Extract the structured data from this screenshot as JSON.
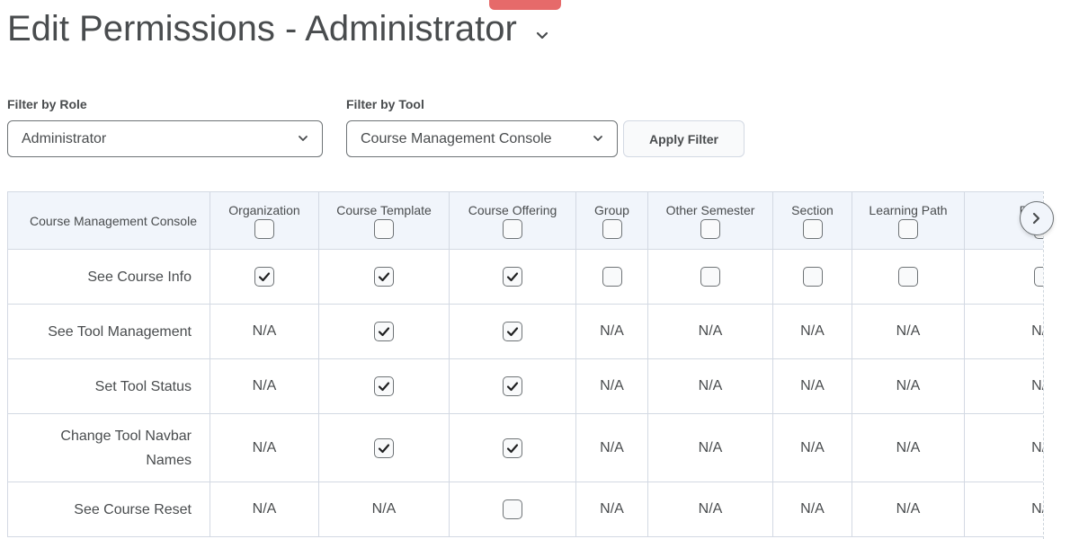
{
  "page": {
    "title": "Edit Permissions - Administrator"
  },
  "filters": {
    "role": {
      "label": "Filter by Role",
      "value": "Administrator"
    },
    "tool": {
      "label": "Filter by Tool",
      "value": "Course Management Console"
    },
    "apply_label": "Apply Filter"
  },
  "table": {
    "tool_header": "Course Management Console",
    "columns": [
      "Organization",
      "Course Template",
      "Course Offering",
      "Group",
      "Other Semester",
      "Section",
      "Learning Path",
      "Program"
    ],
    "rows": [
      {
        "label": "See Course Info",
        "cells": [
          true,
          true,
          true,
          false,
          false,
          false,
          false,
          false
        ]
      },
      {
        "label": "See Tool Management",
        "cells": [
          "N/A",
          true,
          true,
          "N/A",
          "N/A",
          "N/A",
          "N/A",
          "N/A"
        ]
      },
      {
        "label": "Set Tool Status",
        "cells": [
          "N/A",
          true,
          true,
          "N/A",
          "N/A",
          "N/A",
          "N/A",
          "N/A"
        ]
      },
      {
        "label": "Change Tool Navbar Names",
        "cells": [
          "N/A",
          true,
          true,
          "N/A",
          "N/A",
          "N/A",
          "N/A",
          "N/A"
        ]
      },
      {
        "label": "See Course Reset",
        "cells": [
          "N/A",
          "N/A",
          false,
          "N/A",
          "N/A",
          "N/A",
          "N/A",
          "N/A"
        ]
      }
    ]
  },
  "icons": {
    "title_chevron": "chevron-down-icon",
    "select_chevron": "chevron-down-icon",
    "scroll_right": "chevron-right-icon",
    "check": "checkmark-icon"
  },
  "colors": {
    "header_bg": "#f1f5fb",
    "border": "#d3d9e3",
    "text": "#494c4e",
    "accent_tab": "#e66a6a"
  }
}
